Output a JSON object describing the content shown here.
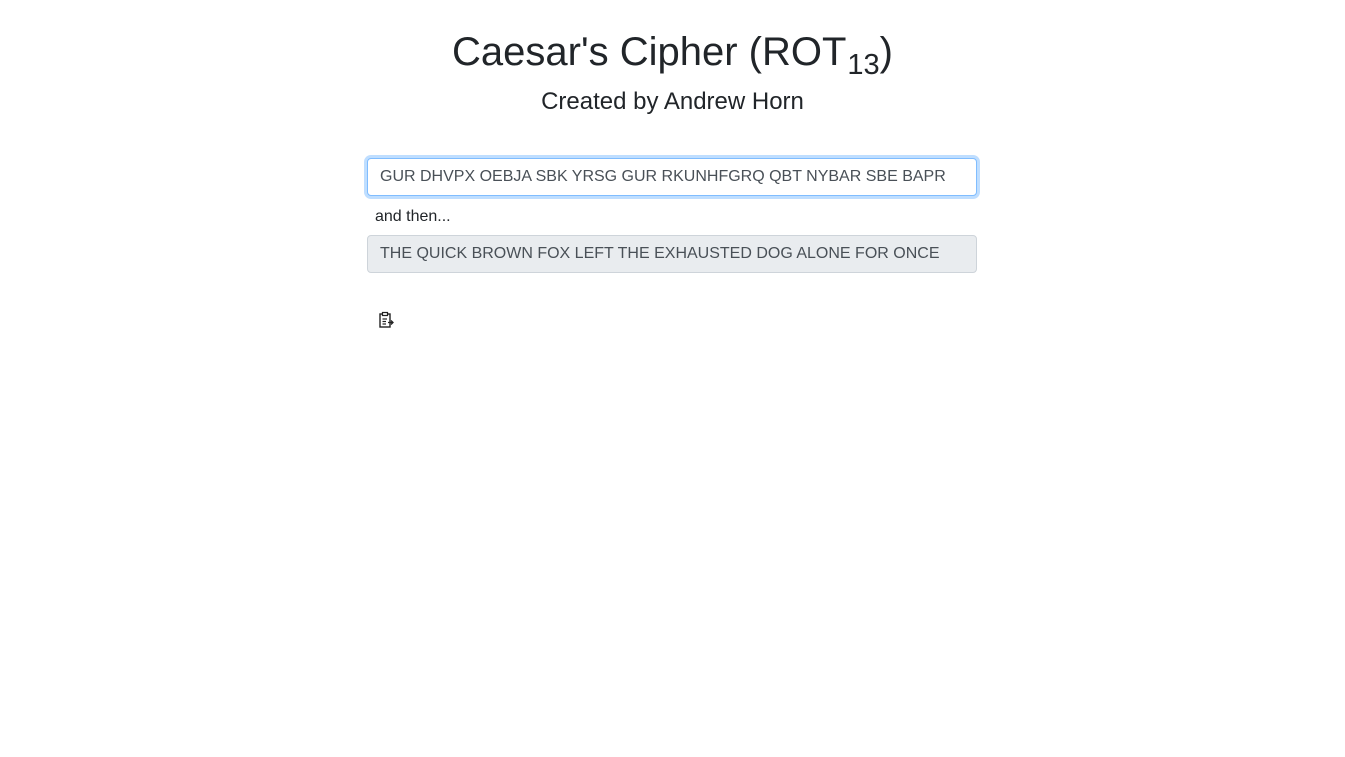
{
  "header": {
    "title_main": "Caesar's Cipher (ROT",
    "title_subscript": "13",
    "title_close": ")",
    "subtitle": "Created by Andrew Horn"
  },
  "cipher": {
    "input_value": "GUR DHVPX OEBJA SBK YRSG GUR RKUNHFGRQ QBT NYBAR SBE BAPR",
    "between_label": "and then...",
    "output_value": "THE QUICK BROWN FOX LEFT THE EXHAUSTED DOG ALONE FOR ONCE"
  },
  "actions": {
    "copy_icon": "clipboard-icon"
  },
  "colors": {
    "focus_border": "#80bdff",
    "readonly_background": "#e9ecef",
    "text": "#212529"
  }
}
